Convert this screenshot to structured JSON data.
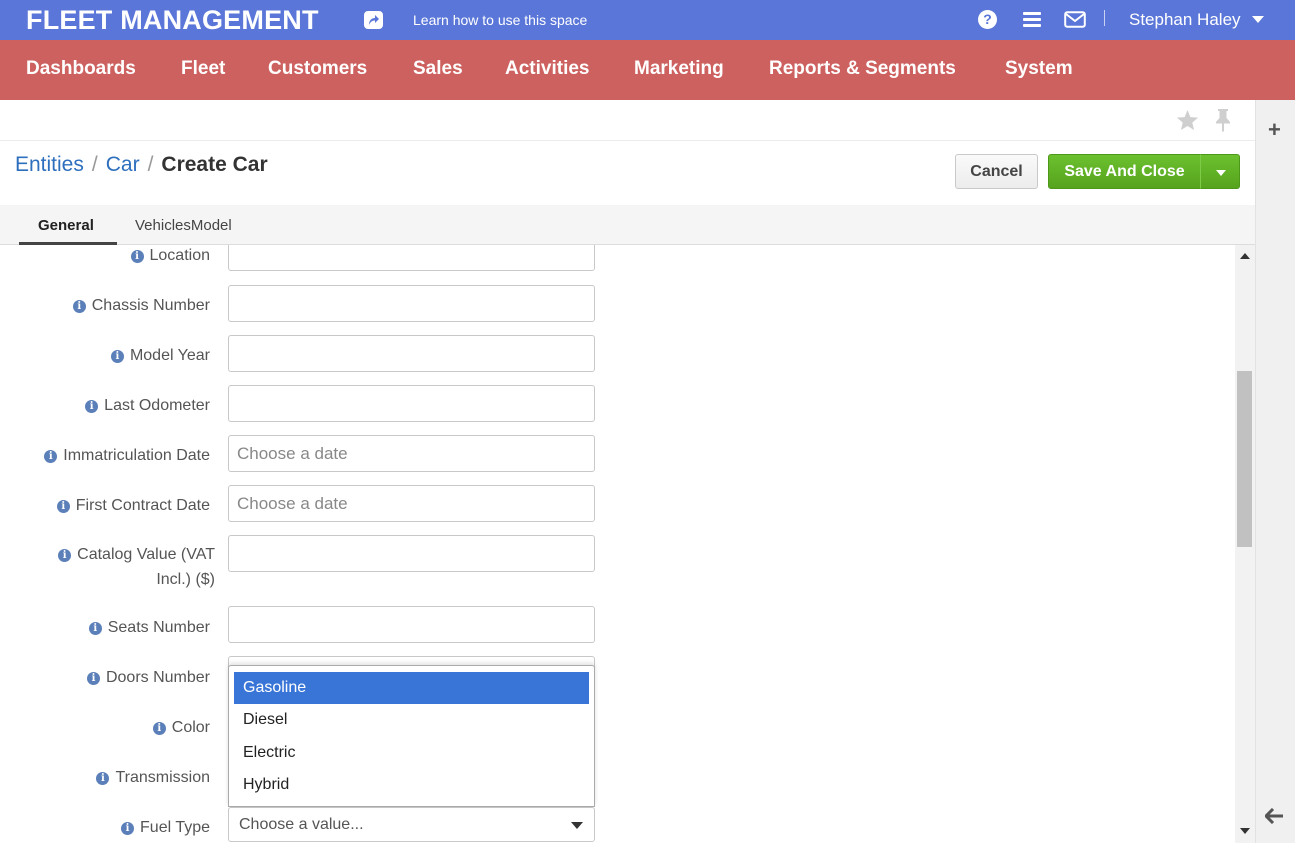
{
  "app": {
    "title": "FLEET MANAGEMENT",
    "learn_link": "Learn how to use this space",
    "help_icon": "?",
    "user_name": "Stephan Haley",
    "colors": {
      "topbar": "#5a76d8",
      "mainnav": "#cd6160",
      "primary_button": "#5fb125",
      "selected_option": "#3875d7"
    }
  },
  "nav": [
    "Dashboards",
    "Fleet",
    "Customers",
    "Sales",
    "Activities",
    "Marketing",
    "Reports & Segments",
    "System"
  ],
  "sidepanel": {
    "add_icon": "+"
  },
  "breadcrumb": {
    "level1": "Entities",
    "level2": "Car",
    "current": "Create Car",
    "separator": "/"
  },
  "actions": {
    "cancel": "Cancel",
    "save_and_close": "Save And Close"
  },
  "tabs": [
    {
      "label": "General",
      "active": true
    },
    {
      "label": "VehiclesModel",
      "active": false
    }
  ],
  "form": {
    "fields": [
      {
        "label": "Location",
        "value": "",
        "placeholder": ""
      },
      {
        "label": "Chassis Number",
        "value": "",
        "placeholder": ""
      },
      {
        "label": "Model Year",
        "value": "",
        "placeholder": ""
      },
      {
        "label": "Last Odometer",
        "value": "",
        "placeholder": ""
      },
      {
        "label": "Immatriculation Date",
        "value": "",
        "placeholder": "Choose a date"
      },
      {
        "label": "First Contract Date",
        "value": "",
        "placeholder": "Choose a date"
      },
      {
        "label": "Catalog Value (VAT Incl.) ($)",
        "value": "",
        "placeholder": ""
      },
      {
        "label": "Seats Number",
        "value": "",
        "placeholder": ""
      },
      {
        "label": "Doors Number",
        "value": "",
        "placeholder": ""
      },
      {
        "label": "Color",
        "value": "",
        "placeholder": ""
      },
      {
        "label": "Transmission",
        "value": "",
        "placeholder": ""
      },
      {
        "label": "Fuel Type",
        "value": "Choose a value..."
      }
    ],
    "fuel_type_options": [
      "Gasoline",
      "Diesel",
      "Electric",
      "Hybrid"
    ],
    "fuel_type_highlighted": "Gasoline"
  }
}
